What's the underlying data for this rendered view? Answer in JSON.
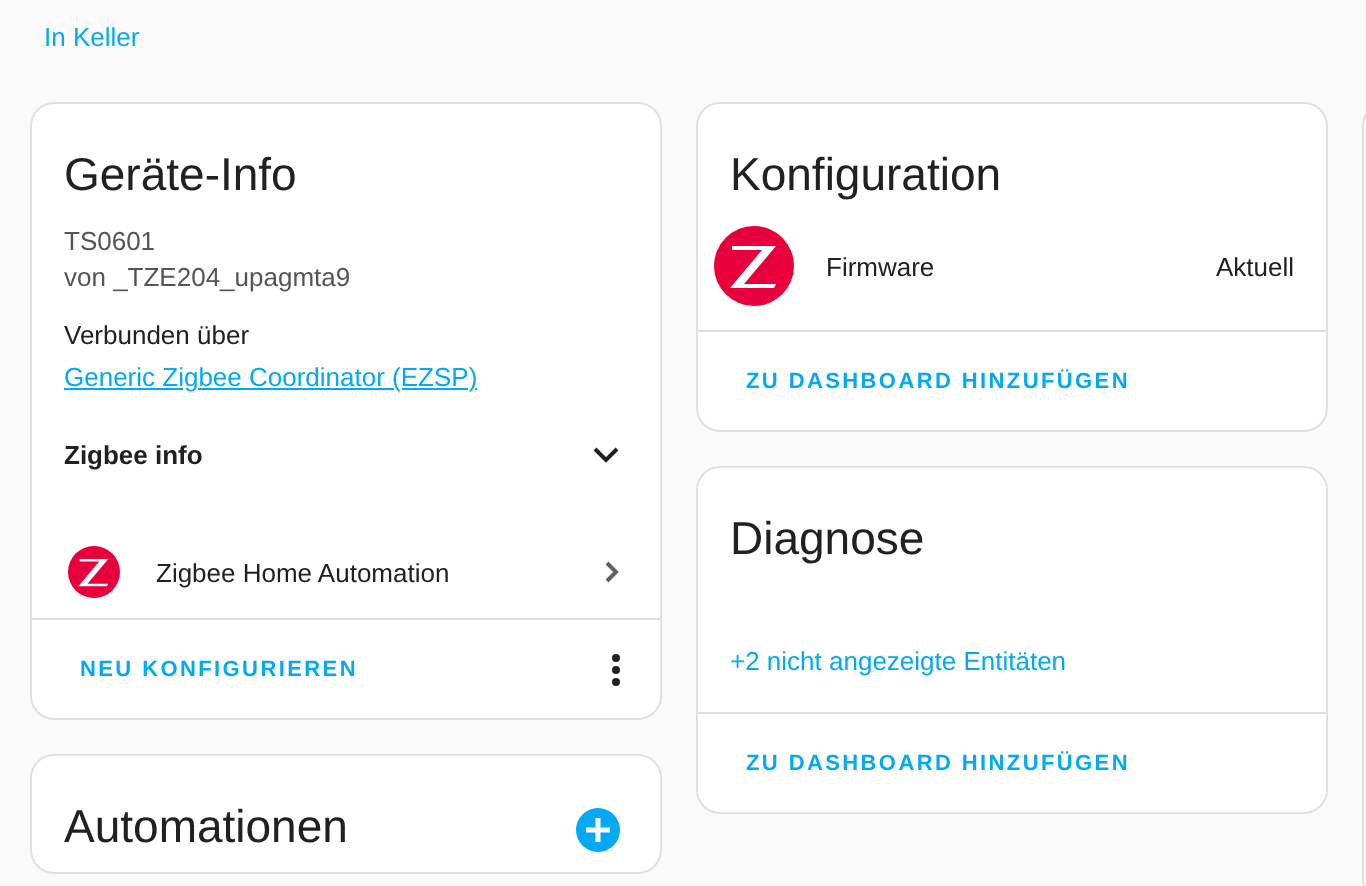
{
  "breadcrumb": "In Keller",
  "device_info": {
    "title": "Geräte-Info",
    "model": "TS0601",
    "manufacturer": "von _TZE204_upagmta9",
    "connected_prefix": "Verbunden über",
    "connected_link": "Generic Zigbee Coordinator (EZSP)",
    "expander": {
      "label": "Zigbee info",
      "expanded": false
    },
    "integration": "Zigbee Home Automation",
    "action": "NEU KONFIGURIEREN"
  },
  "configuration": {
    "title": "Konfiguration",
    "rows": [
      {
        "name": "Firmware",
        "state": "Aktuell"
      }
    ],
    "action": "ZU DASHBOARD HINZUFÜGEN"
  },
  "diagnostics": {
    "title": "Diagnose",
    "hidden_link": "+2 nicht angezeigte Entitäten",
    "action": "ZU DASHBOARD HINZUFÜGEN"
  },
  "automations": {
    "title": "Automationen"
  }
}
